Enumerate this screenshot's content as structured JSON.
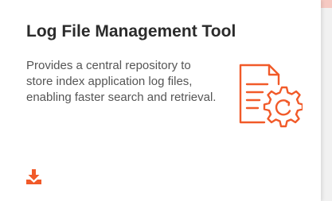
{
  "card": {
    "title": "Log File Management Tool",
    "description": "Provides a central repository to store index application log files, enabling faster search and retrieval.",
    "icon": "log-file-gear-icon",
    "action_icon": "download-icon"
  },
  "colors": {
    "accent": "#f15a29",
    "title": "#2b2b2b",
    "text": "#555555",
    "card_bg": "#ffffff",
    "page_bg": "#f1f1f1"
  }
}
